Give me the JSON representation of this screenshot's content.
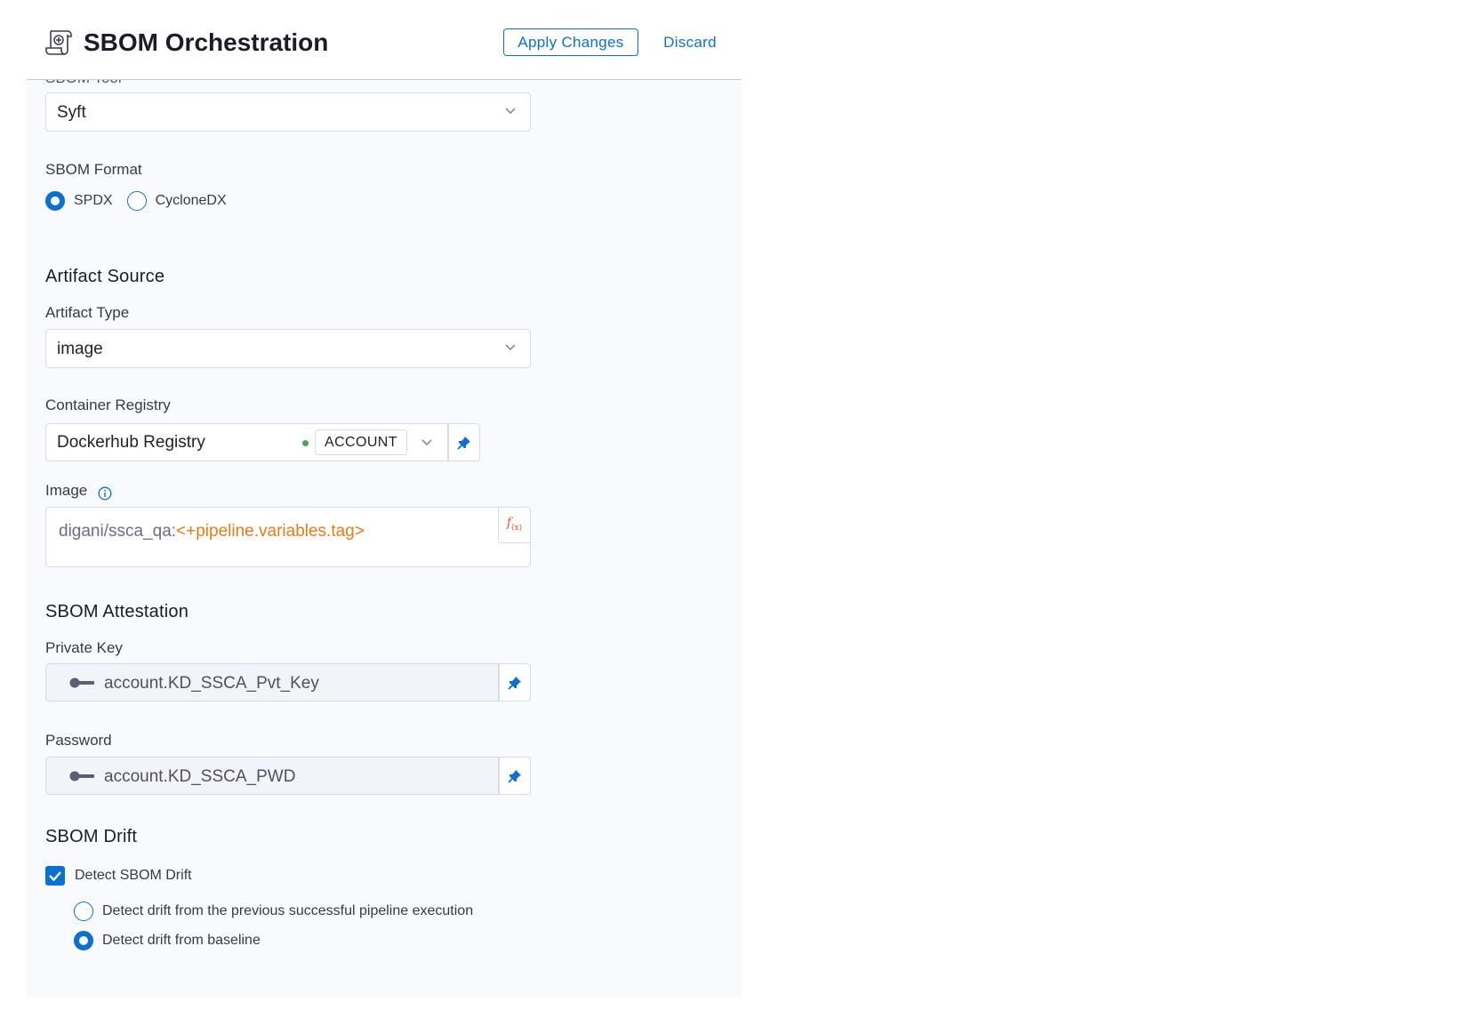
{
  "header": {
    "title": "SBOM Orchestration",
    "apply_label": "Apply Changes",
    "discard_label": "Discard"
  },
  "sbom_tool": {
    "label": "SBOM Tool",
    "value": "Syft"
  },
  "sbom_format": {
    "label": "SBOM Format",
    "options": [
      {
        "label": "SPDX",
        "selected": true
      },
      {
        "label": "CycloneDX",
        "selected": false
      }
    ]
  },
  "artifact_source": {
    "section_title": "Artifact Source",
    "artifact_type_label": "Artifact Type",
    "artifact_type_value": "image",
    "registry_label": "Container Registry",
    "registry_value": "Dockerhub Registry",
    "registry_scope": "ACCOUNT",
    "image_label": "Image",
    "image_prefix": "digani/ssca_qa:",
    "image_expression": "<+pipeline.variables.tag>"
  },
  "attestation": {
    "section_title": "SBOM Attestation",
    "private_key_label": "Private Key",
    "private_key_value": "account.KD_SSCA_Pvt_Key",
    "password_label": "Password",
    "password_value": "account.KD_SSCA_PWD"
  },
  "drift": {
    "section_title": "SBOM Drift",
    "checkbox_label": "Detect SBOM Drift",
    "checked": true,
    "options": [
      {
        "label": "Detect drift from the previous successful pipeline execution",
        "selected": false
      },
      {
        "label": "Detect drift from baseline",
        "selected": true
      }
    ]
  },
  "colors": {
    "accent": "#0b6fd4",
    "expression": "#e67c14",
    "status_green": "#42ab45"
  }
}
